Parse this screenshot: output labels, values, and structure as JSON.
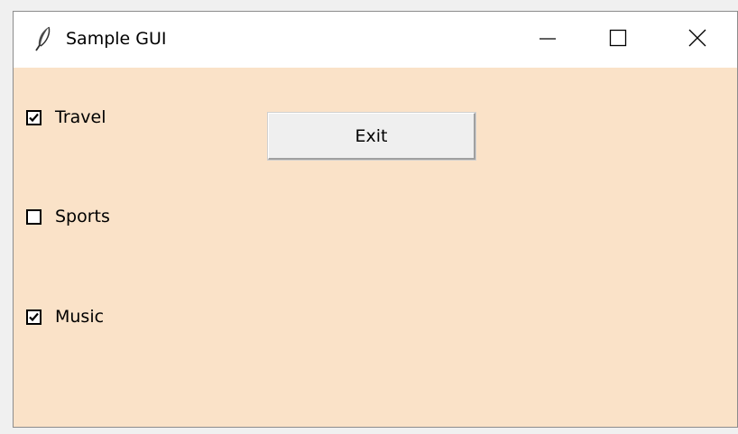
{
  "window": {
    "title": "Sample GUI",
    "app_icon": "feather-icon",
    "controls": {
      "minimize_icon": "minimize-icon",
      "maximize_icon": "maximize-icon",
      "close_icon": "close-icon"
    }
  },
  "colors": {
    "client_background": "#fae2c8",
    "titlebar_background": "#ffffff",
    "button_face": "#efefef"
  },
  "checkboxes": [
    {
      "label": "Travel",
      "checked": true
    },
    {
      "label": "Sports",
      "checked": false
    },
    {
      "label": "Music",
      "checked": true
    }
  ],
  "exit_button": {
    "label": "Exit"
  }
}
